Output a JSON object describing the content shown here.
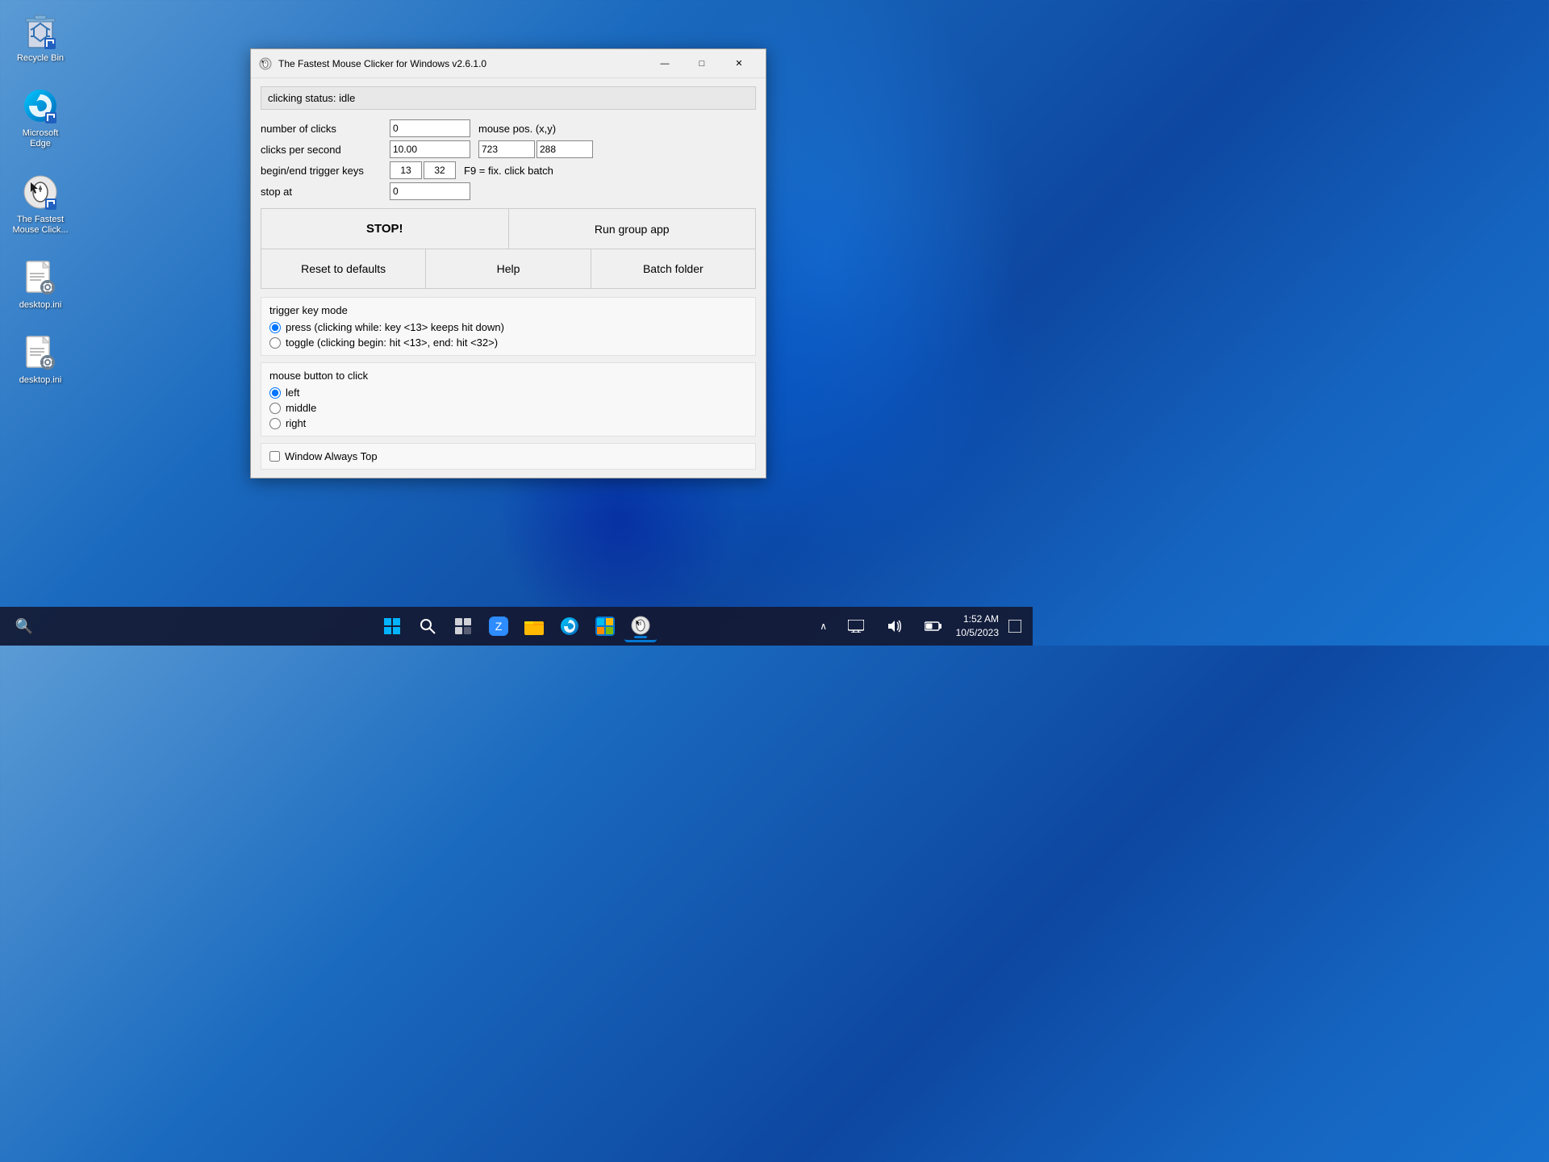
{
  "desktop": {
    "icons": [
      {
        "id": "recycle-bin",
        "label": "Recycle Bin",
        "icon_type": "recycle"
      },
      {
        "id": "microsoft-edge",
        "label": "Microsoft Edge",
        "icon_type": "edge"
      },
      {
        "id": "fastest-mouse",
        "label": "The Fastest Mouse Click...",
        "icon_type": "mouse"
      },
      {
        "id": "desktop-ini-1",
        "label": "desktop.ini",
        "icon_type": "file"
      },
      {
        "id": "desktop-ini-2",
        "label": "desktop.ini",
        "icon_type": "file"
      }
    ]
  },
  "app_window": {
    "title": "The Fastest Mouse Clicker for Windows v2.6.1.0",
    "status_label": "clicking status:",
    "status_value": "idle",
    "fields": {
      "num_clicks_label": "number of clicks",
      "num_clicks_value": "0",
      "clicks_per_sec_label": "clicks per second",
      "clicks_per_sec_value": "10.00",
      "trigger_keys_label": "begin/end trigger keys",
      "trigger_key1": "13",
      "trigger_key2": "32",
      "stop_at_label": "stop at",
      "stop_at_value": "0",
      "mouse_pos_label": "mouse pos. (x,y)",
      "mouse_x": "723",
      "mouse_y": "288",
      "fix_click_batch": "F9 = fix. click batch"
    },
    "buttons": {
      "stop": "STOP!",
      "run_group": "Run group app",
      "reset": "Reset to defaults",
      "help": "Help",
      "batch_folder": "Batch folder"
    },
    "trigger_key_mode": {
      "title": "trigger key mode",
      "options": [
        {
          "id": "press",
          "label": "press (clicking while: key <13> keeps hit down)",
          "checked": true
        },
        {
          "id": "toggle",
          "label": "toggle (clicking begin: hit <13>, end: hit <32>)",
          "checked": false
        }
      ]
    },
    "mouse_button": {
      "title": "mouse button to click",
      "options": [
        {
          "id": "left",
          "label": "left",
          "checked": true
        },
        {
          "id": "middle",
          "label": "middle",
          "checked": false
        },
        {
          "id": "right",
          "label": "right",
          "checked": false
        }
      ]
    },
    "window_always_top": {
      "label": "Window Always Top",
      "checked": false
    }
  },
  "titlebar": {
    "minimize": "—",
    "maximize": "□",
    "close": "✕"
  },
  "taskbar": {
    "icons": [
      {
        "id": "start",
        "symbol": "⊞",
        "label": "Start"
      },
      {
        "id": "search",
        "symbol": "🔍",
        "label": "Search"
      },
      {
        "id": "task-view",
        "symbol": "⬛",
        "label": "Task View"
      },
      {
        "id": "zoom",
        "symbol": "🎥",
        "label": "Zoom"
      },
      {
        "id": "explorer",
        "symbol": "📁",
        "label": "File Explorer"
      },
      {
        "id": "edge",
        "symbol": "🌐",
        "label": "Microsoft Edge"
      },
      {
        "id": "store",
        "symbol": "🛒",
        "label": "Microsoft Store"
      },
      {
        "id": "mouse-clicker",
        "symbol": "🖱",
        "label": "Fastest Mouse Clicker"
      }
    ],
    "system_tray": {
      "chevron": "^",
      "icons": [
        "🖥",
        "🔊",
        "🔋"
      ],
      "time": "1:52 AM",
      "date": "10/5/2023"
    }
  }
}
